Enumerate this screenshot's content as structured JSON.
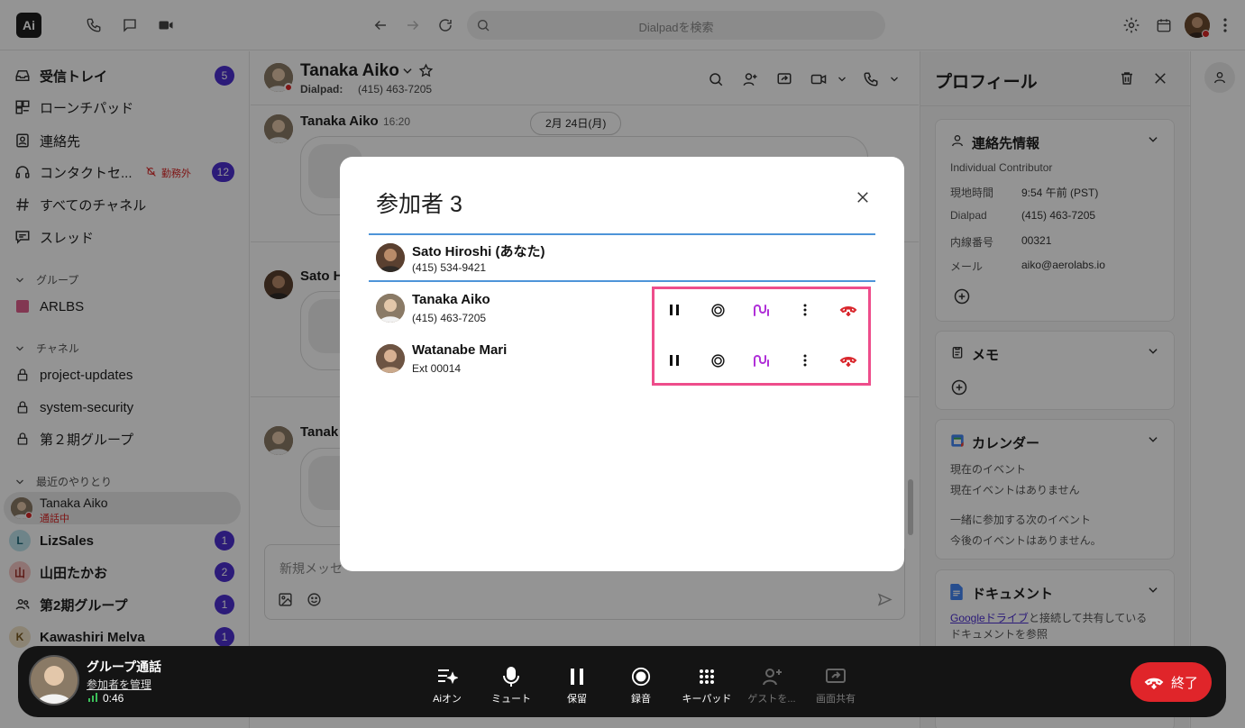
{
  "topbar": {
    "logo": "Ai",
    "search_placeholder": "Dialpadを検索"
  },
  "sidebar": {
    "items": [
      {
        "label": "受信トレイ",
        "badge": "5",
        "icon": "inbox-icon"
      },
      {
        "label": "ローンチパッド",
        "icon": "launchpad-icon"
      },
      {
        "label": "連絡先",
        "icon": "contacts-icon"
      },
      {
        "label": "コンタクトセ...",
        "status": "勤務外",
        "badge": "12",
        "icon": "headset-icon"
      },
      {
        "label": "すべてのチャネル",
        "icon": "hash-icon"
      },
      {
        "label": "スレッド",
        "icon": "thread-icon"
      }
    ],
    "groups_title": "グループ",
    "groups": [
      {
        "label": "ARLBS"
      }
    ],
    "channels_title": "チャネル",
    "channels": [
      {
        "label": "project-updates"
      },
      {
        "label": "system-security"
      },
      {
        "label": "第２期グループ"
      }
    ],
    "recent_title": "最近のやりとり",
    "recent": [
      {
        "label": "Tanaka Aiko",
        "sub": "通話中"
      },
      {
        "label": "LizSales",
        "letter": "L",
        "badge": "1"
      },
      {
        "label": "山田たかお",
        "letter": "山",
        "badge": "2"
      },
      {
        "label": "第2期グループ",
        "badge": "1"
      },
      {
        "label": "Kawashiri Melva",
        "letter": "K",
        "badge": "1"
      }
    ]
  },
  "conversation": {
    "name": "Tanaka Aiko",
    "sub_label": "Dialpad:",
    "sub_number": "(415) 463-7205",
    "date_chip": "2月 24日(月)",
    "messages": [
      {
        "sender": "Tanaka Aiko",
        "time": "16:20"
      },
      {
        "sender": "Sato H"
      },
      {
        "sender": "Tanak"
      }
    ],
    "composer_placeholder": "新規メッセ"
  },
  "profile": {
    "title": "プロフィール",
    "contact": {
      "title": "連絡先情報",
      "role": "Individual Contributor",
      "rows": [
        {
          "k": "現地時間",
          "v": "9:54 午前 (PST)"
        },
        {
          "k": "Dialpad",
          "v": "(415) 463-7205"
        },
        {
          "k": "内線番号",
          "v": "00321"
        },
        {
          "k": "メール",
          "v": "aiko@aerolabs.io"
        }
      ]
    },
    "memo_title": "メモ",
    "calendar": {
      "title": "カレンダー",
      "current_label": "現在のイベント",
      "current_value": "現在イベントはありません",
      "next_label": "一緒に参加する次のイベント",
      "next_value": "今後のイベントはありません。"
    },
    "docs": {
      "title": "ドキュメント",
      "link": "Googleドライブ",
      "text1": " と接続して共有している",
      "text2": "ドキュメントを参照"
    }
  },
  "modal": {
    "title": "参加者 3",
    "participants": [
      {
        "name": "Sato Hiroshi (あなた)",
        "number": "(415) 534-9421"
      },
      {
        "name": "Tanaka Aiko",
        "number": "(415) 463-7205"
      },
      {
        "name": "Watanabe Mari",
        "number": "Ext 00014"
      }
    ],
    "highlight_color": "#ee4d8b",
    "hangup_color": "#d9262c",
    "ai_color": "#b030d8"
  },
  "callbar": {
    "title": "グループ通話",
    "manage_link": "参加者を管理",
    "timer": "0:46",
    "buttons": [
      {
        "label": "Aiオン",
        "icon": "ai-on-icon"
      },
      {
        "label": "ミュート",
        "icon": "microphone-icon"
      },
      {
        "label": "保留",
        "icon": "pause-icon"
      },
      {
        "label": "録音",
        "icon": "record-icon"
      },
      {
        "label": "キーパッド",
        "icon": "keypad-icon"
      },
      {
        "label": "ゲストを...",
        "icon": "add-guest-icon"
      },
      {
        "label": "画面共有",
        "icon": "screen-share-icon"
      }
    ],
    "end_label": "終了",
    "end_color": "#e0252a"
  }
}
